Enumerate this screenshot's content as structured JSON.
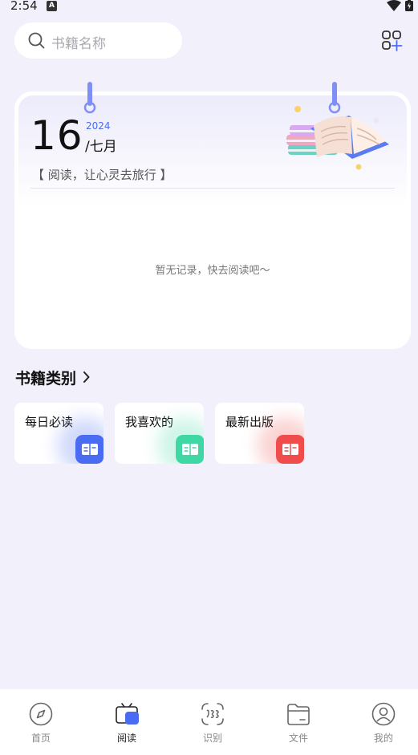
{
  "status": {
    "time": "2:54",
    "a_badge": "A"
  },
  "search": {
    "placeholder": "书籍名称"
  },
  "calendar": {
    "day": "16",
    "year": "2024",
    "month": "/七月",
    "slogan": "【 阅读，让心灵去旅行 】",
    "empty_text": "暂无记录，快去阅读吧～"
  },
  "categories": {
    "title": "书籍类别",
    "items": [
      {
        "label": "每日必读",
        "color": "#4a6cf3"
      },
      {
        "label": "我喜欢的",
        "color": "#3fd8a4"
      },
      {
        "label": "最新出版",
        "color": "#f14c4c"
      }
    ]
  },
  "nav": {
    "items": [
      {
        "label": "首页",
        "icon": "compass-icon"
      },
      {
        "label": "阅读",
        "icon": "tv-read-icon"
      },
      {
        "label": "识别",
        "icon": "scan-icon"
      },
      {
        "label": "文件",
        "icon": "folder-icon"
      },
      {
        "label": "我的",
        "icon": "user-icon"
      }
    ],
    "active": "阅读"
  }
}
